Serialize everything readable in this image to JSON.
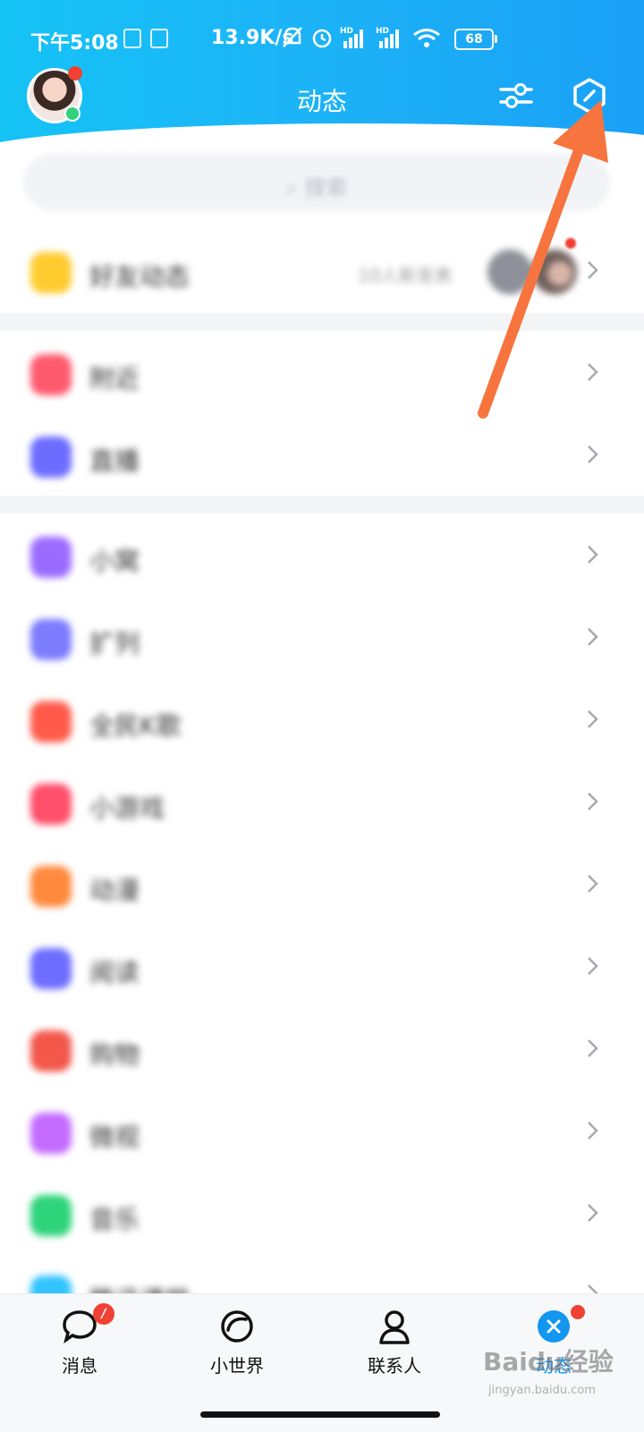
{
  "status_bar": {
    "time": "下午5:08",
    "net_speed": "13.9K/s",
    "battery": "68"
  },
  "header": {
    "title": "动态"
  },
  "search": {
    "placeholder": "搜索"
  },
  "friends_feed": {
    "label": "好友动态",
    "extra": "10人新发表"
  },
  "section_two": [
    {
      "label": "附近",
      "icon": "location-icon",
      "color": "#ff5a6e"
    },
    {
      "label": "直播",
      "icon": "live-icon",
      "color": "#6c6cff"
    }
  ],
  "section_three": [
    {
      "label": "小窝",
      "icon": "home-icon",
      "color": "#9b6bff"
    },
    {
      "label": "扩列",
      "icon": "friends-icon",
      "color": "#7c7cff"
    },
    {
      "label": "全民K歌",
      "icon": "karaoke-icon",
      "color": "#ff5a4a"
    },
    {
      "label": "小游戏",
      "icon": "game-icon",
      "color": "#ff4f6a"
    },
    {
      "label": "动漫",
      "icon": "anime-icon",
      "color": "#ff8a3d"
    },
    {
      "label": "阅读",
      "icon": "book-icon",
      "color": "#6d6dff"
    },
    {
      "label": "购物",
      "icon": "shop-icon",
      "color": "#f2574a"
    },
    {
      "label": "微视",
      "icon": "video-icon",
      "color": "#c36bff"
    },
    {
      "label": "音乐",
      "icon": "music-icon",
      "color": "#2ed47a"
    },
    {
      "label": "腾讯课堂",
      "icon": "class-icon",
      "color": "#33c4ff"
    }
  ],
  "tabs": [
    {
      "label": "消息",
      "icon": "message-icon"
    },
    {
      "label": "小世界",
      "icon": "world-icon"
    },
    {
      "label": "联系人",
      "icon": "contacts-icon"
    },
    {
      "label": "动态",
      "icon": "dynamic-icon"
    }
  ],
  "watermark": {
    "brand": "Baidu经验",
    "url": "jingyan.baidu.com"
  },
  "colors": {
    "header_start": "#15c3f5",
    "header_end": "#1aa0f6",
    "arrow": "#f7743f",
    "badge": "#f04134",
    "active_tab": "#1296f0"
  }
}
